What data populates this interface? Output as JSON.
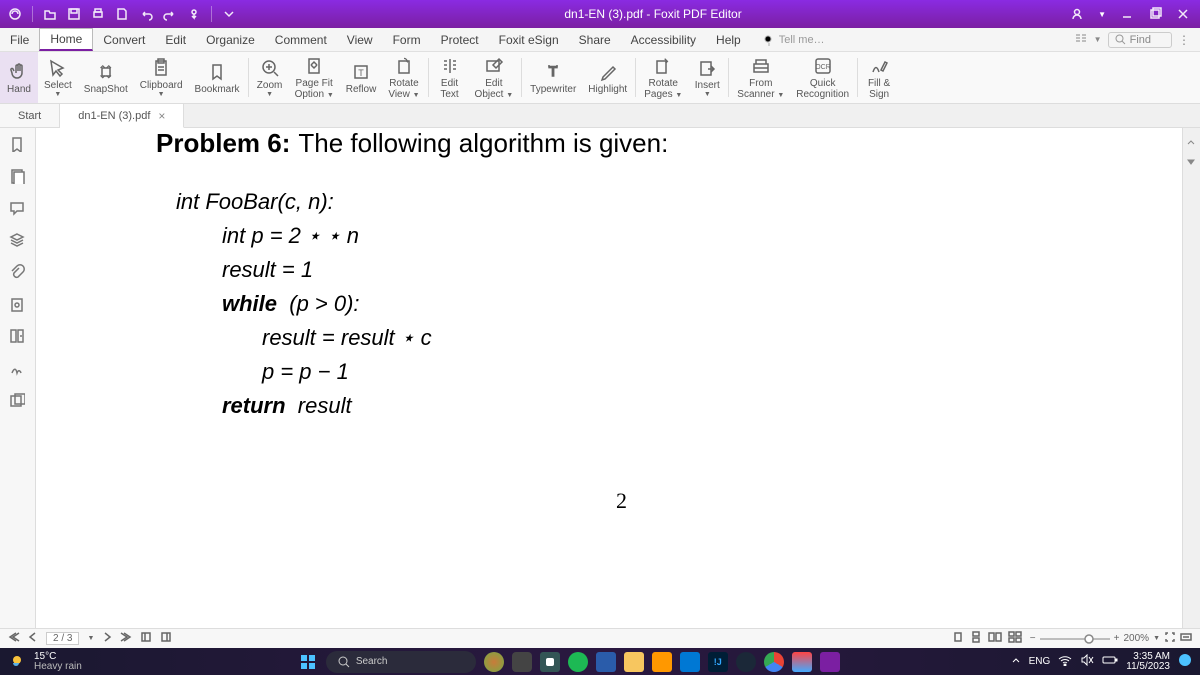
{
  "titlebar": {
    "title": "dn1-EN (3).pdf - Foxit PDF Editor"
  },
  "menu": {
    "items": [
      "File",
      "Home",
      "Convert",
      "Edit",
      "Organize",
      "Comment",
      "View",
      "Form",
      "Protect",
      "Foxit eSign",
      "Share",
      "Accessibility",
      "Help"
    ],
    "active": 1,
    "tellme": "Tell me…",
    "find": "Find"
  },
  "ribbon": {
    "buttons": [
      {
        "icon": "hand",
        "l1": "Hand",
        "dd": false
      },
      {
        "icon": "select",
        "l1": "Select",
        "dd": true
      },
      {
        "icon": "snapshot",
        "l1": "SnapShot",
        "dd": false
      },
      {
        "icon": "clipboard",
        "l1": "Clipboard",
        "dd": true
      },
      {
        "icon": "bookmark",
        "l1": "Bookmark",
        "dd": false
      },
      {
        "sep": true
      },
      {
        "icon": "zoom",
        "l1": "Zoom",
        "dd": true
      },
      {
        "icon": "pagefit",
        "l1": "Page Fit",
        "l2": "Option",
        "dd": true
      },
      {
        "icon": "reflow",
        "l1": "Reflow",
        "dd": false
      },
      {
        "icon": "rotate",
        "l1": "Rotate",
        "l2": "View",
        "dd": true
      },
      {
        "sep": true
      },
      {
        "icon": "edittext",
        "l1": "Edit",
        "l2": "Text",
        "dd": false
      },
      {
        "icon": "editobj",
        "l1": "Edit",
        "l2": "Object",
        "dd": true
      },
      {
        "sep": true
      },
      {
        "icon": "typewriter",
        "l1": "Typewriter",
        "dd": false
      },
      {
        "icon": "highlight",
        "l1": "Highlight",
        "dd": false
      },
      {
        "sep": true
      },
      {
        "icon": "rotatepages",
        "l1": "Rotate",
        "l2": "Pages",
        "dd": true
      },
      {
        "icon": "insert",
        "l1": "Insert",
        "dd": true
      },
      {
        "sep": true
      },
      {
        "icon": "scanner",
        "l1": "From",
        "l2": "Scanner",
        "dd": true
      },
      {
        "icon": "ocr",
        "l1": "Quick",
        "l2": "Recognition",
        "dd": false
      },
      {
        "sep": true
      },
      {
        "icon": "fillsign",
        "l1": "Fill &",
        "l2": "Sign",
        "dd": false
      }
    ]
  },
  "tabs": {
    "start": "Start",
    "file": "dn1-EN (3).pdf"
  },
  "leftrail": [
    "bookmark",
    "pages",
    "comments",
    "layers",
    "attach",
    "security",
    "thumb",
    "sign",
    "share"
  ],
  "document": {
    "heading_bold": "Problem 6:",
    "heading_rest": "The following algorithm is given:",
    "lines": [
      {
        "ind": 0,
        "html": "int FooBar(c, n):"
      },
      {
        "ind": 1,
        "html": "int p = 2 ⋆ ⋆ n"
      },
      {
        "ind": 1,
        "html": "result = 1"
      },
      {
        "ind": 1,
        "html": "<b>while</b>&nbsp;&nbsp;(p > 0):"
      },
      {
        "ind": 2,
        "html": "result = result ⋆ c"
      },
      {
        "ind": 2,
        "html": "p = p − 1"
      },
      {
        "ind": 1,
        "html": "<b>return</b>&nbsp;&nbsp;result"
      }
    ],
    "pagenum": "2"
  },
  "botnav": {
    "page": "2 / 3",
    "zoom": "200%"
  },
  "taskbar": {
    "temp": "15°C",
    "wlabel": "Heavy rain",
    "search": "Search",
    "lang": "ENG",
    "time": "3:35 AM",
    "date": "11/5/2023"
  }
}
